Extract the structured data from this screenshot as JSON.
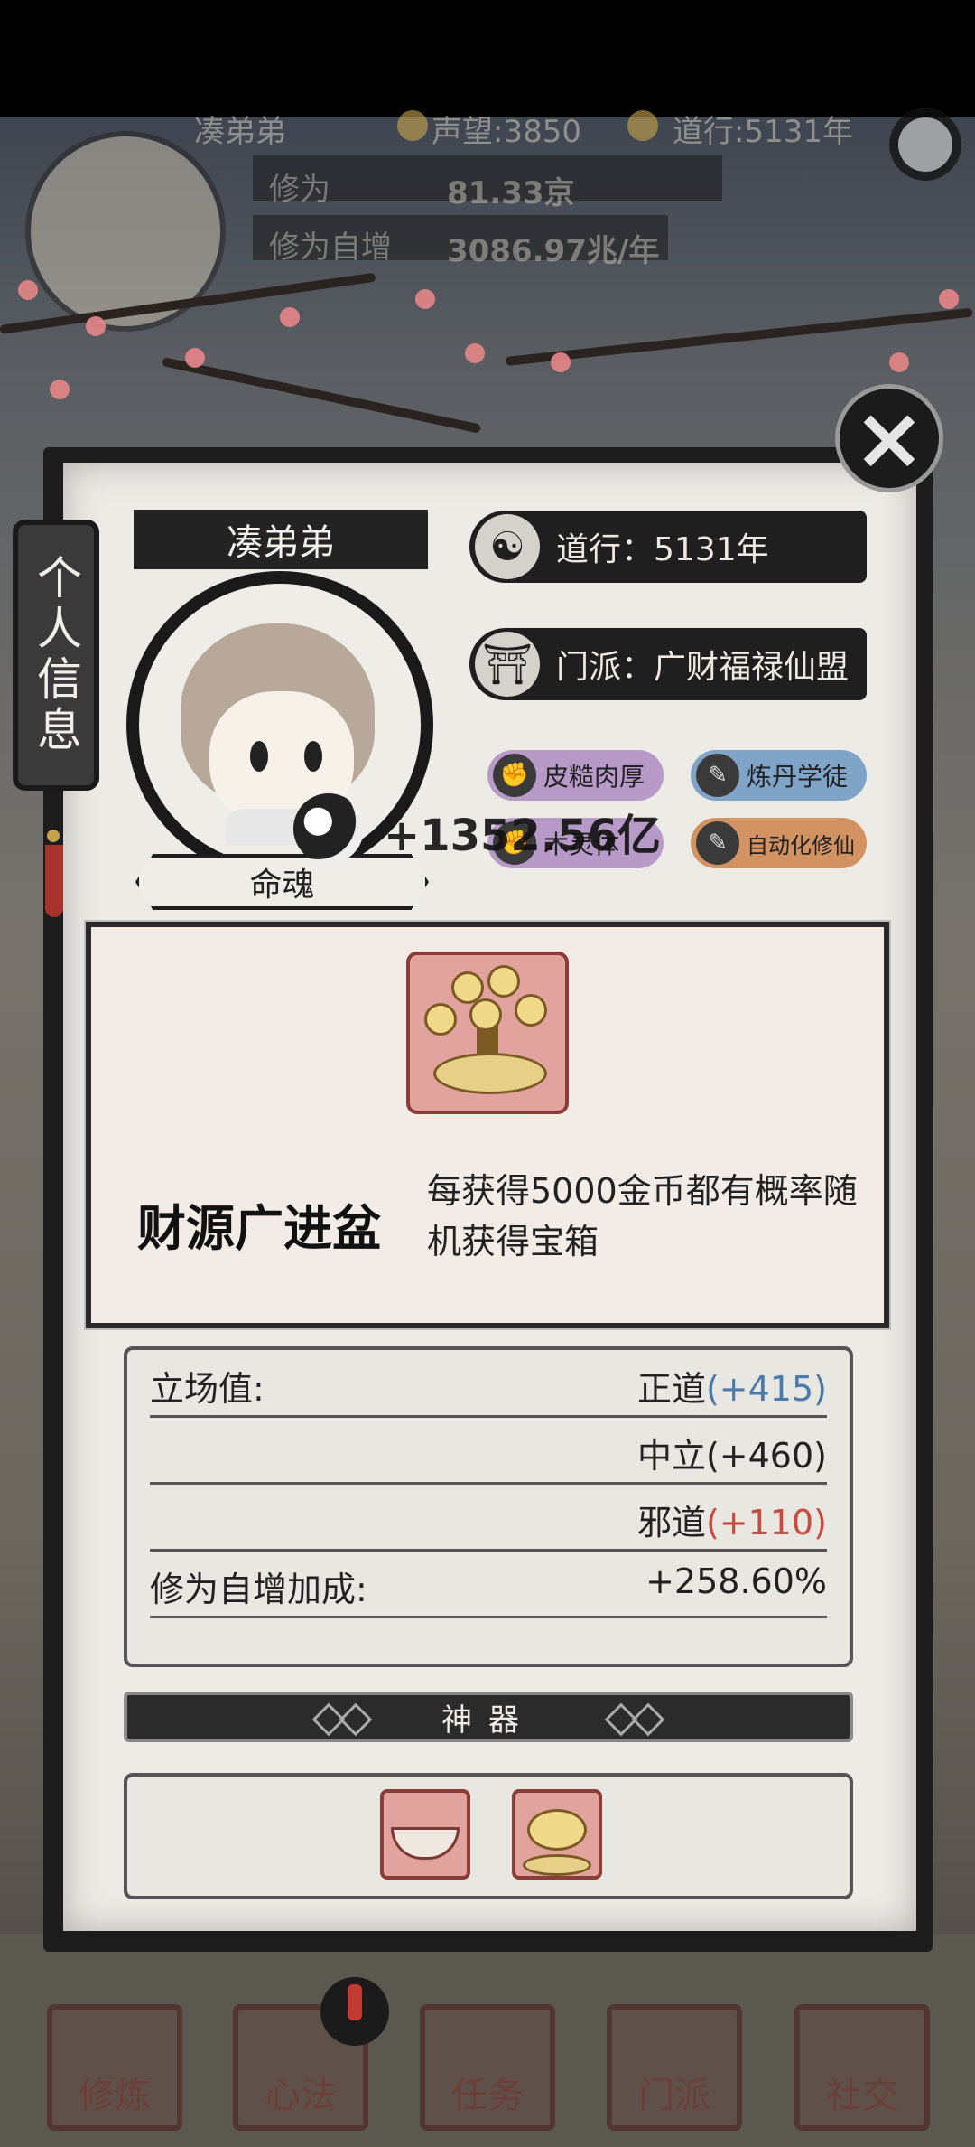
{
  "hud": {
    "player_name": "凑弟弟",
    "reputation": "声望:3850",
    "dao_years": "道行:5131年",
    "rows": [
      {
        "label": "修为",
        "value": "81.33京"
      },
      {
        "label": "修为自增",
        "value": "3086.97兆/年"
      }
    ]
  },
  "side_tab": {
    "label": "个人信息"
  },
  "profile": {
    "name": "凑弟弟",
    "soul_label": "命魂",
    "dao_line": "道行：5131年",
    "sect_line": "门派：广财福禄仙盟",
    "traits": [
      {
        "label": "皮糙肉厚",
        "color": "purple"
      },
      {
        "label": "炼丹学徒",
        "color": "blue"
      },
      {
        "label": "木灵体",
        "color": "purple"
      },
      {
        "label": "自动化修仙",
        "color": "orange"
      }
    ]
  },
  "floating_gain": "+1352.56亿",
  "tooltip": {
    "name": "财源广进盆",
    "description": "每获得5000金币都有概率随机获得宝箱"
  },
  "stats": {
    "stance_label": "立场值:",
    "righteous_label": "正道",
    "righteous_value": "(+415)",
    "neutral": "中立(+460)",
    "evil_label": "邪道",
    "evil_value": "(+110)",
    "cultivation_bonus_label": "修为自增加成:",
    "cultivation_bonus_value": "+258.60%"
  },
  "artifacts": {
    "header": "神器",
    "items": [
      "bowl-artifact",
      "money-tree-artifact"
    ]
  },
  "nav": [
    {
      "label": "修炼"
    },
    {
      "label": "心法"
    },
    {
      "label": "任务"
    },
    {
      "label": "门派"
    },
    {
      "label": "社交"
    }
  ],
  "colors": {
    "panel": "#ecebe6",
    "ink": "#1f1f1f",
    "righteous": "#4c7ba8",
    "evil": "#c64b43",
    "accent_red": "#a8322c"
  }
}
